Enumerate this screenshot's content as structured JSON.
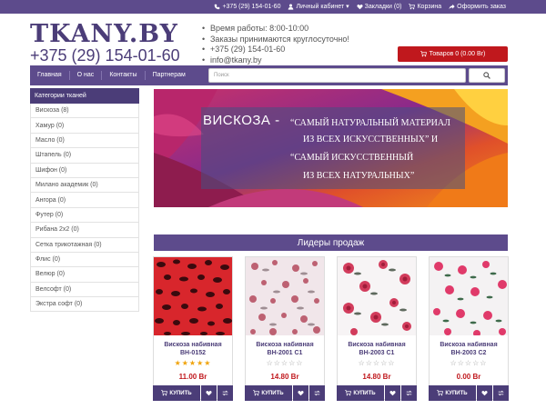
{
  "topbar": {
    "phone": "+375 (29) 154-01-60",
    "account": "Личный кабинет",
    "bookmarks": "Закладки (0)",
    "cart": "Корзина",
    "checkout": "Оформить заказ"
  },
  "header": {
    "brand": "TKANY.BY",
    "phone": "+375 (29) 154-01-60",
    "info": [
      "Время работы: 8:00-10:00",
      "Заказы принимаются круглосуточно!",
      "+375 (29) 154-01-60",
      "info@tkany.by"
    ],
    "cart_button": "Товаров 0 (0.00 Br)"
  },
  "nav": {
    "items": [
      "Главная",
      "О нас",
      "Контакты",
      "Партнерам"
    ],
    "search_placeholder": "Поиск"
  },
  "sidebar": {
    "title": "Категории тканей",
    "items": [
      "Вискоза (8)",
      "Хамур (0)",
      "Масло (0)",
      "Штапель (0)",
      "Шифон (0)",
      "Милано академик (0)",
      "Ангора (0)",
      "Футер (0)",
      "Рибана 2х2 (0)",
      "Сетка трикотажная (0)",
      "Флис (0)",
      "Велюр (0)",
      "Велсофт (0)",
      "Экстра софт (0)"
    ]
  },
  "banner": {
    "title": "ВИСКОЗА -",
    "lines": [
      "“САМЫЙ НАТУРАЛЬНЫЙ МАТЕРИАЛ",
      "ИЗ ВСЕХ ИСКУССТВЕННЫХ” И",
      "“САМЫЙ ИСКУССТВЕННЫЙ",
      "ИЗ ВСЕХ НАТУРАЛЬНЫХ”"
    ]
  },
  "leaders_title": "Лидеры продаж",
  "products": [
    {
      "name_line1": "Вискоза набивная",
      "name_line2": "ВН-0152",
      "price": "11.00 Br",
      "rating": 5,
      "buy": "КУПИТЬ"
    },
    {
      "name_line1": "Вискоза набивная",
      "name_line2": "ВН-2001 С1",
      "price": "14.80 Br",
      "rating": 0,
      "buy": "КУПИТЬ"
    },
    {
      "name_line1": "Вискоза набивная",
      "name_line2": "ВН-2003 С1",
      "price": "14.80 Br",
      "rating": 0,
      "buy": "КУПИТЬ"
    },
    {
      "name_line1": "Вискоза набивная",
      "name_line2": "ВН-2003 С2",
      "price": "0.00 Br",
      "rating": 0,
      "buy": "КУПИТЬ"
    }
  ],
  "colors": {
    "brand": "#4b3d78",
    "nav": "#5d4b8c",
    "accent_red": "#c0181d",
    "star": "#f0a30a"
  }
}
